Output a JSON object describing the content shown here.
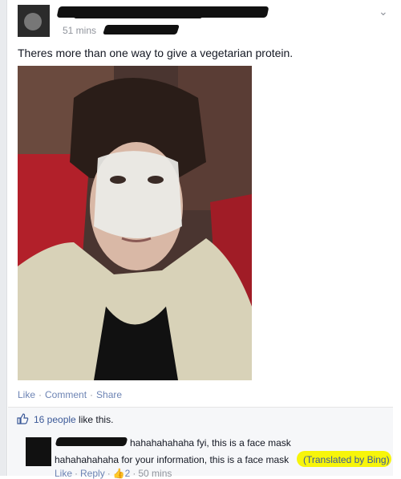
{
  "post": {
    "timestamp": "51 mins",
    "text": "Theres more than one way to give a vegetarian protein.",
    "actions": {
      "like": "Like",
      "comment": "Comment",
      "share": "Share"
    }
  },
  "likes": {
    "count_text": "16 people",
    "suffix": " like this."
  },
  "comment": {
    "original_text": "hahahahahaha fyi, this is a face mask",
    "translated_text": "hahahahahaha for your information, this is a face mask",
    "translation_label": "(Translated by Bing)",
    "actions": {
      "like": "Like",
      "reply": "Reply",
      "likes_count": "2",
      "time": "50 mins"
    }
  },
  "colors": {
    "link": "#3b5998",
    "highlight": "#f7f50a",
    "bar": "#f6f7f9"
  }
}
